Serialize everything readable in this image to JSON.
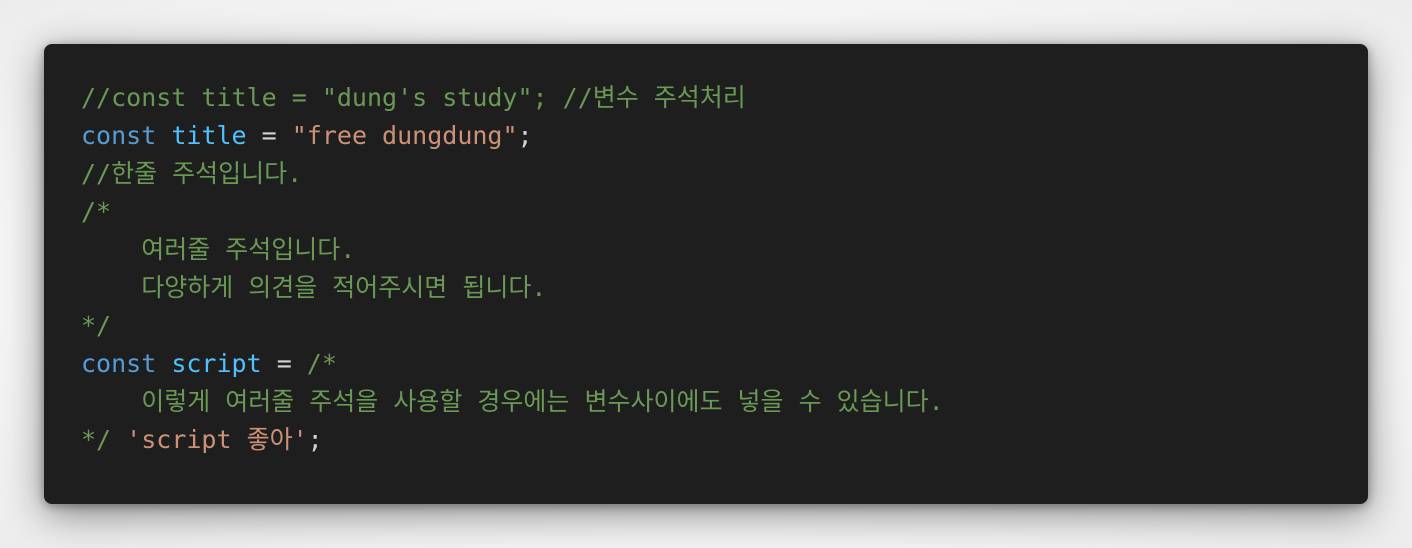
{
  "code": {
    "lines": [
      [
        {
          "type": "comment",
          "text": "//const title = \"dung's study\"; //변수 주석처리"
        }
      ],
      [
        {
          "type": "keyword",
          "text": "const"
        },
        {
          "type": "ws",
          "text": " "
        },
        {
          "type": "var",
          "text": "title"
        },
        {
          "type": "op",
          "text": " = "
        },
        {
          "type": "string",
          "text": "\"free dungdung\""
        },
        {
          "type": "punct",
          "text": ";"
        }
      ],
      [
        {
          "type": "comment",
          "text": "//한줄 주석입니다."
        }
      ],
      [
        {
          "type": "comment",
          "text": "/*"
        }
      ],
      [
        {
          "type": "comment",
          "text": "    여러줄 주석입니다."
        }
      ],
      [
        {
          "type": "comment",
          "text": "    다양하게 의견을 적어주시면 됩니다."
        }
      ],
      [
        {
          "type": "comment",
          "text": "*/"
        }
      ],
      [
        {
          "type": "keyword",
          "text": "const"
        },
        {
          "type": "ws",
          "text": " "
        },
        {
          "type": "var",
          "text": "script"
        },
        {
          "type": "op",
          "text": " = "
        },
        {
          "type": "comment",
          "text": "/*"
        }
      ],
      [
        {
          "type": "comment",
          "text": "    이렇게 여러줄 주석을 사용할 경우에는 변수사이에도 넣을 수 있습니다."
        }
      ],
      [
        {
          "type": "comment",
          "text": "*/"
        },
        {
          "type": "ws",
          "text": " "
        },
        {
          "type": "string",
          "text": "'script 좋아'"
        },
        {
          "type": "punct",
          "text": ";"
        }
      ]
    ]
  },
  "colors": {
    "background": "#1e1e1e",
    "comment": "#6a9955",
    "keyword": "#569cd6",
    "variable": "#4fc1ff",
    "string": "#ce9178",
    "default": "#d4d4d4"
  }
}
